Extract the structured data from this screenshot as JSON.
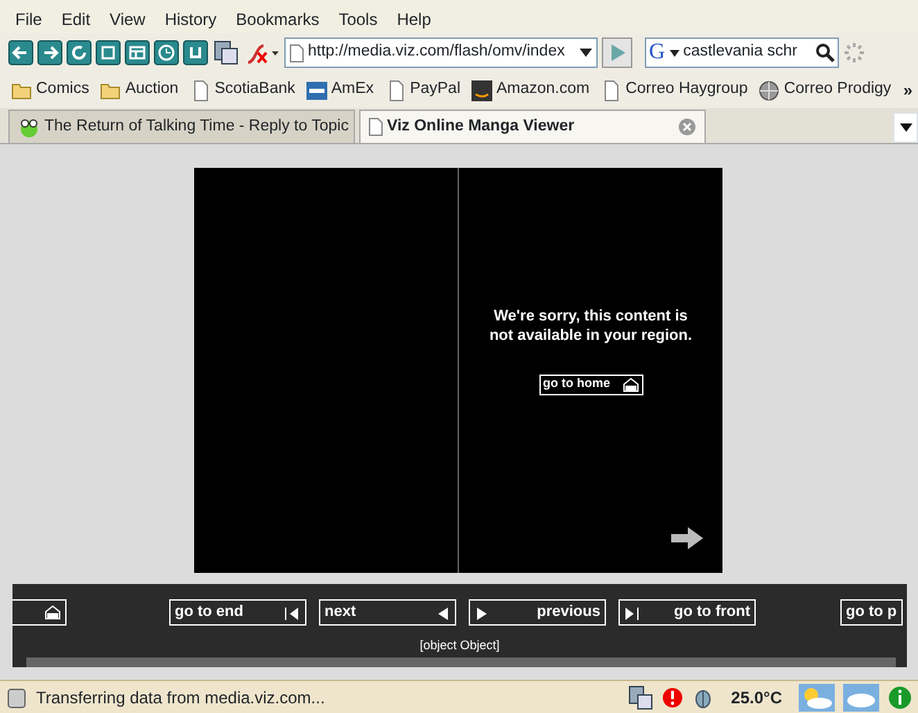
{
  "menu": [
    "File",
    "Edit",
    "View",
    "History",
    "Bookmarks",
    "Tools",
    "Help"
  ],
  "toolbar": {
    "url": "http://media.viz.com/flash/omv/index",
    "search_engine_logo": "G",
    "search": "castlevania schr"
  },
  "bookmarks": [
    {
      "label": "Comics",
      "kind": "folder"
    },
    {
      "label": "Auction",
      "kind": "folder"
    },
    {
      "label": "ScotiaBank",
      "kind": "page"
    },
    {
      "label": "AmEx",
      "kind": "card"
    },
    {
      "label": "PayPal",
      "kind": "page"
    },
    {
      "label": "Amazon.com",
      "kind": "amazon"
    },
    {
      "label": "Correo Haygroup",
      "kind": "page"
    },
    {
      "label": "Correo Prodigy",
      "kind": "globe"
    }
  ],
  "bookmarks_more": "»",
  "tabs": [
    {
      "title": "The Return of Talking Time - Reply to Topic",
      "selected": false
    },
    {
      "title": "Viz Online Manga Viewer",
      "selected": true
    }
  ],
  "viewer": {
    "message": "We're sorry, this content is not available in your region.",
    "home_button": "go to home",
    "nav_buttons": [
      {
        "kind": "home"
      },
      {
        "label": "go to end",
        "kind": "end"
      },
      {
        "label": "next",
        "kind": "next"
      },
      {
        "label": "previous",
        "kind": "prev"
      },
      {
        "label": "go to front",
        "kind": "front"
      },
      {
        "label": "go to p",
        "kind": "plain"
      }
    ],
    "caption": "[object Object]"
  },
  "status_bar": {
    "text": "Transferring data from media.viz.com...",
    "temperature": "25.0°C"
  }
}
